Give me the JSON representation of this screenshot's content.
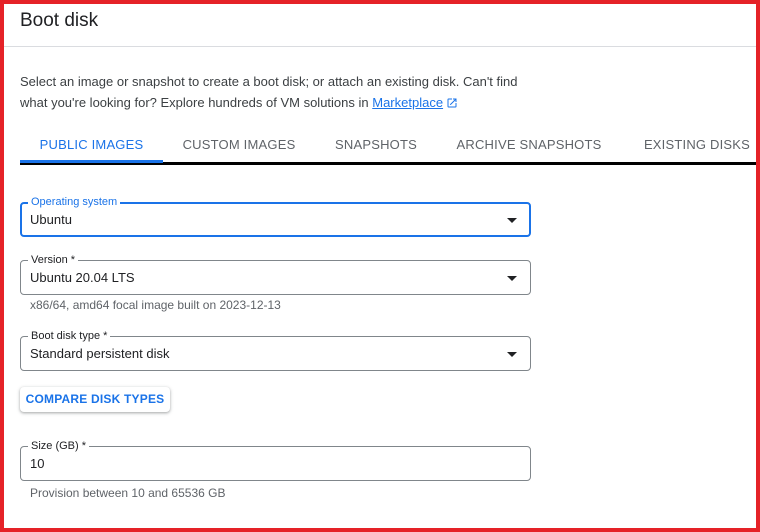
{
  "panel": {
    "title": "Boot disk",
    "intro_line1": "Select an image or snapshot to create a boot disk; or attach an existing disk. Can't find",
    "intro_line2": "what you're looking for? Explore hundreds of VM solutions in",
    "marketplace_link": "Marketplace"
  },
  "tabs": [
    {
      "label": "PUBLIC IMAGES",
      "active": true
    },
    {
      "label": "CUSTOM IMAGES",
      "active": false
    },
    {
      "label": "SNAPSHOTS",
      "active": false
    },
    {
      "label": "ARCHIVE SNAPSHOTS",
      "active": false
    },
    {
      "label": "EXISTING DISKS",
      "active": false
    }
  ],
  "form": {
    "operating_system": {
      "label": "Operating system",
      "value": "Ubuntu"
    },
    "version": {
      "label": "Version *",
      "value": "Ubuntu 20.04 LTS",
      "hint": "x86/64, amd64 focal image built on 2023-12-13"
    },
    "boot_disk_type": {
      "label": "Boot disk type *",
      "value": "Standard persistent disk"
    },
    "compare_button": "COMPARE DISK TYPES",
    "size": {
      "label": "Size (GB) *",
      "value": "10",
      "hint": "Provision between 10 and 65536 GB"
    }
  },
  "colors": {
    "accent": "#1a73e8",
    "frame_border": "#e52228",
    "tab_bar_line": "#000000",
    "muted_text": "#5f6368"
  },
  "icons": {
    "external_link": "open-in-new-icon",
    "dropdown": "arrow-drop-down-icon"
  }
}
